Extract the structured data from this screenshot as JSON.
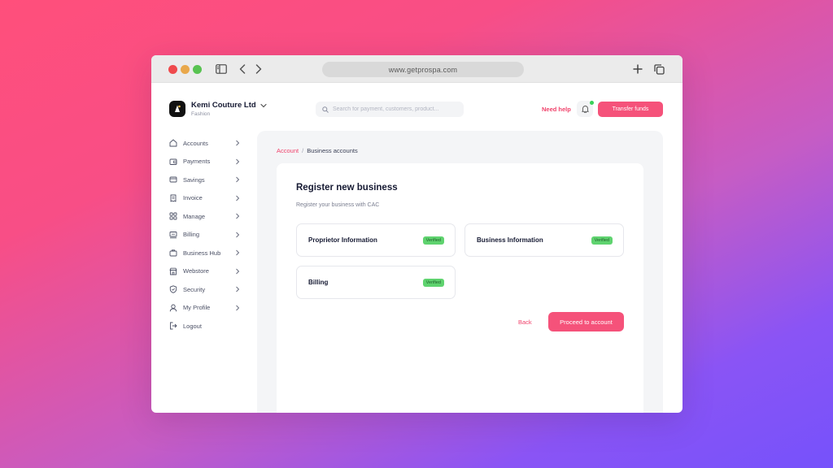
{
  "browser": {
    "url": "www.getprospa.com"
  },
  "brand": {
    "name": "Kemi Couture Ltd",
    "category": "Fashion"
  },
  "search": {
    "placeholder": "Search for payment, customers, product..."
  },
  "header": {
    "need_help": "Need help",
    "transfer_button": "Transfer funds",
    "notification_color": "#3ad05a"
  },
  "sidebar": {
    "items": [
      {
        "label": "Accounts",
        "icon": "home-icon"
      },
      {
        "label": "Payments",
        "icon": "wallet-icon"
      },
      {
        "label": "Savings",
        "icon": "card-icon"
      },
      {
        "label": "Invoice",
        "icon": "receipt-icon"
      },
      {
        "label": "Manage",
        "icon": "grid-icon"
      },
      {
        "label": "Billing",
        "icon": "billing-icon"
      },
      {
        "label": "Business Hub",
        "icon": "briefcase-icon"
      },
      {
        "label": "Webstore",
        "icon": "store-icon"
      },
      {
        "label": "Security",
        "icon": "shield-icon"
      },
      {
        "label": "My Profile",
        "icon": "user-icon"
      },
      {
        "label": "Logout",
        "icon": "logout-icon"
      }
    ]
  },
  "breadcrumb": {
    "parent": "Account",
    "separator": "/",
    "current": "Business accounts"
  },
  "register": {
    "title": "Register new business",
    "subtitle": "Register your business with CAC",
    "sections": [
      {
        "title": "Proprietor Information",
        "status": "Verified"
      },
      {
        "title": "Business Information",
        "status": "Verified"
      },
      {
        "title": "Billing",
        "status": "Verified"
      }
    ],
    "back_label": "Back",
    "proceed_label": "Proceed to account"
  },
  "colors": {
    "accent": "#f5527a",
    "verified": "#5fd36f",
    "text_dark": "#161a33"
  }
}
